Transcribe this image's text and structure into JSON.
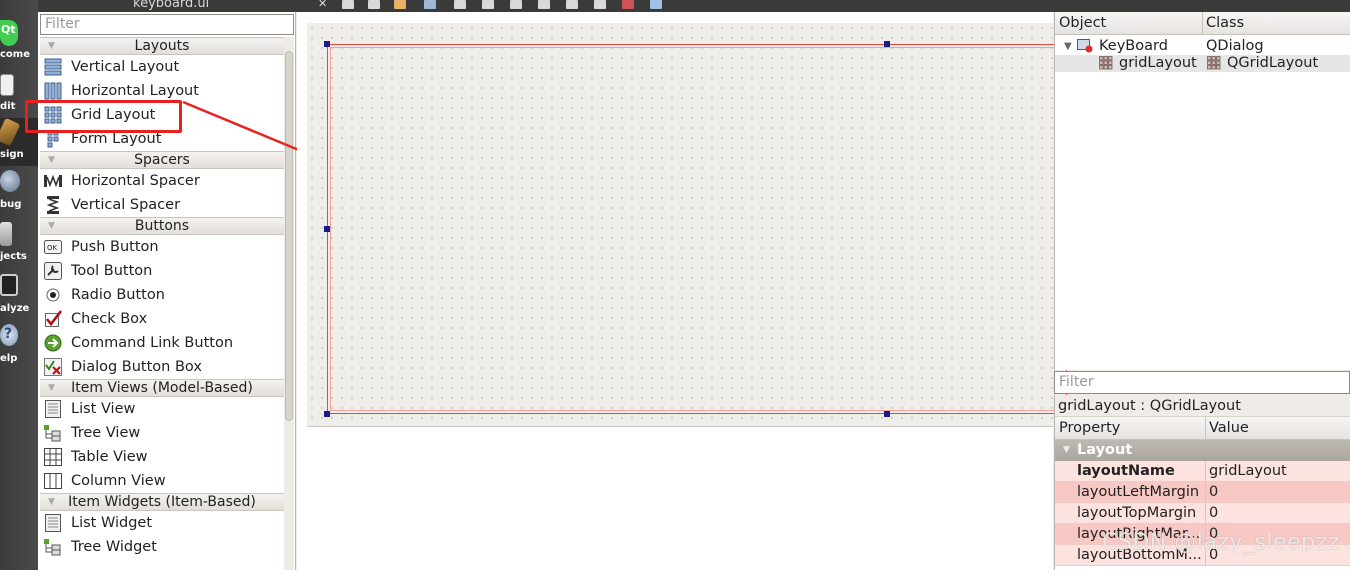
{
  "app": {
    "file_tab": "keyboard.ui"
  },
  "modes": [
    {
      "label": "come",
      "icon": "qt-logo-icon"
    },
    {
      "label": "dit",
      "icon": "edit-document-icon"
    },
    {
      "label": "sign",
      "icon": "design-brush-icon"
    },
    {
      "label": "bug",
      "icon": "debug-bug-icon"
    },
    {
      "label": "jects",
      "icon": "projects-wrench-icon"
    },
    {
      "label": "alyze",
      "icon": "analyze-monitor-icon"
    },
    {
      "label": "elp",
      "icon": "help-question-icon"
    }
  ],
  "widget_box": {
    "filter_placeholder": "Filter",
    "categories": [
      {
        "title": "Layouts",
        "items": [
          "Vertical Layout",
          "Horizontal Layout",
          "Grid Layout",
          "Form Layout"
        ]
      },
      {
        "title": "Spacers",
        "items": [
          "Horizontal Spacer",
          "Vertical Spacer"
        ]
      },
      {
        "title": "Buttons",
        "items": [
          "Push Button",
          "Tool Button",
          "Radio Button",
          "Check Box",
          "Command Link Button",
          "Dialog Button Box"
        ]
      },
      {
        "title": "Item Views (Model-Based)",
        "items": [
          "List View",
          "Tree View",
          "Table View",
          "Column View"
        ]
      },
      {
        "title": "Item Widgets (Item-Based)",
        "items": [
          "List Widget",
          "Tree Widget"
        ]
      }
    ]
  },
  "object_inspector": {
    "col_object": "Object",
    "col_class": "Class",
    "rows": [
      {
        "object": "KeyBoard",
        "class": "QDialog"
      },
      {
        "object": "gridLayout",
        "class": "QGridLayout"
      }
    ]
  },
  "property_editor": {
    "filter_placeholder": "Filter",
    "object_label": "gridLayout : QGridLayout",
    "col_property": "Property",
    "col_value": "Value",
    "group": "Layout",
    "rows": [
      {
        "name": "layoutName",
        "value": "gridLayout"
      },
      {
        "name": "layoutLeftMargin",
        "value": "0"
      },
      {
        "name": "layoutTopMargin",
        "value": "0"
      },
      {
        "name": "layoutRightMar...",
        "value": "0"
      },
      {
        "name": "layoutBottomM...",
        "value": "0"
      }
    ]
  },
  "watermark": "CSDN @lazy_sleepzz",
  "colors": {
    "annotation": "#e8201f",
    "layout_border": "#e8443a",
    "handle": "#1a1a8c"
  }
}
